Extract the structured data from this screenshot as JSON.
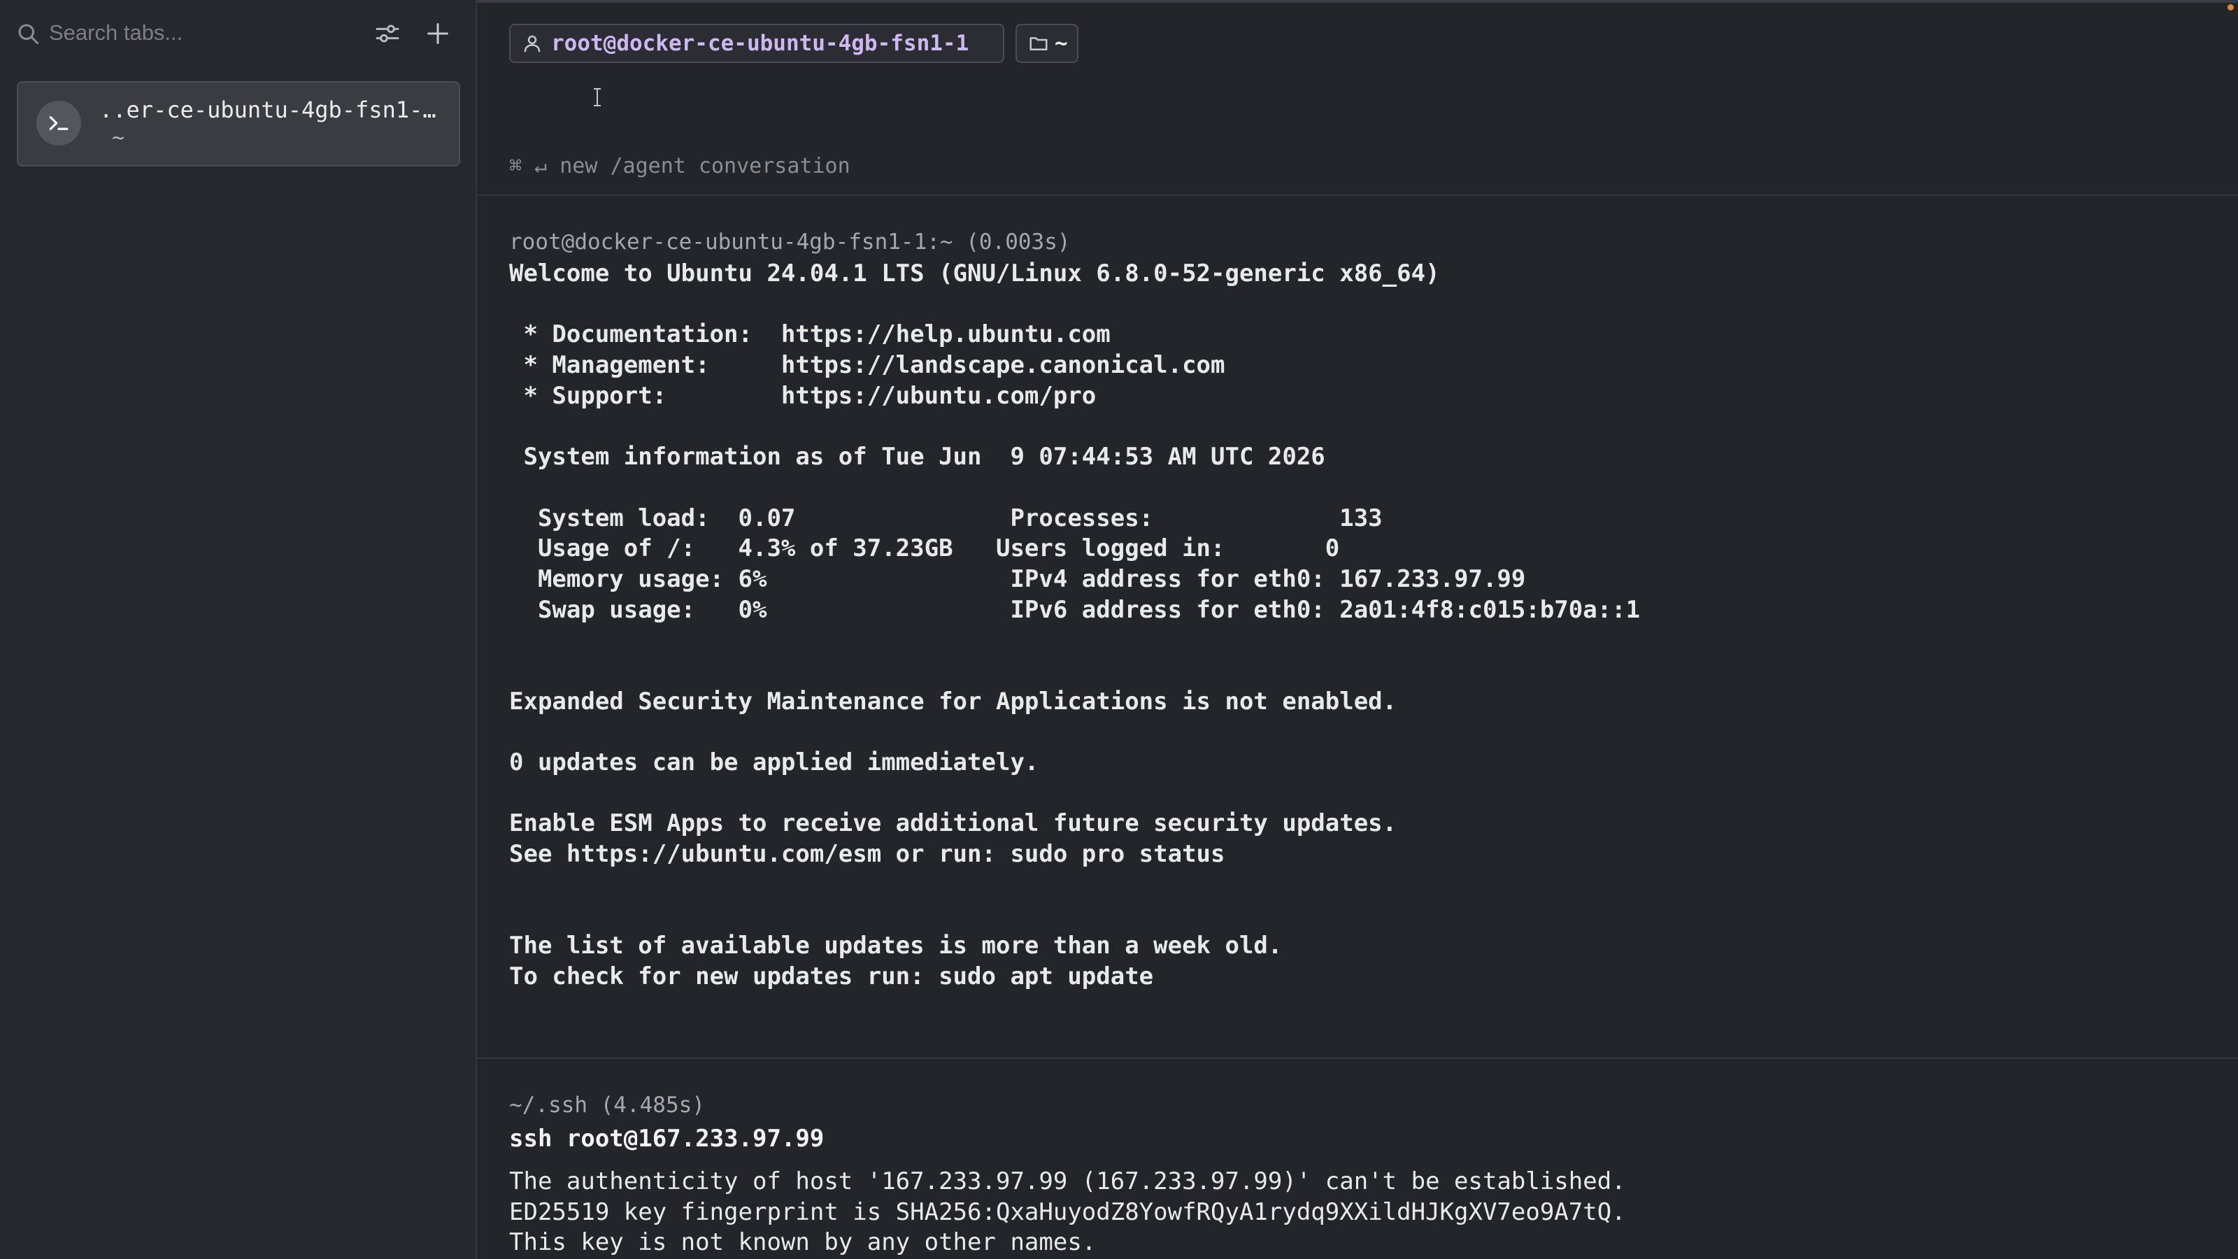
{
  "sidebar": {
    "search": {
      "placeholder": "Search tabs..."
    },
    "tabs": [
      {
        "title": "..er-ce-ubuntu-4gb-fsn1-…",
        "subtitle": "~"
      }
    ]
  },
  "header": {
    "user_host": "root@docker-ce-ubuntu-4gb-fsn1-1",
    "directory": "~"
  },
  "agent_hint": "⌘ ↵ new /agent conversation",
  "blocks": [
    {
      "header": "root@docker-ce-ubuntu-4gb-fsn1-1:~ (0.003s)",
      "lines": [
        "Welcome to Ubuntu 24.04.1 LTS (GNU/Linux 6.8.0-52-generic x86_64)",
        "",
        " * Documentation:  https://help.ubuntu.com",
        " * Management:     https://landscape.canonical.com",
        " * Support:        https://ubuntu.com/pro",
        "",
        " System information as of Tue Jun  9 07:44:53 AM UTC 2026",
        "",
        "  System load:  0.07               Processes:             133",
        "  Usage of /:   4.3% of 37.23GB   Users logged in:       0",
        "  Memory usage: 6%                 IPv4 address for eth0: 167.233.97.99",
        "  Swap usage:   0%                 IPv6 address for eth0: 2a01:4f8:c015:b70a::1",
        "",
        "",
        "Expanded Security Maintenance for Applications is not enabled.",
        "",
        "0 updates can be applied immediately.",
        "",
        "Enable ESM Apps to receive additional future security updates.",
        "See https://ubuntu.com/esm or run: sudo pro status",
        "",
        "",
        "The list of available updates is more than a week old.",
        "To check for new updates run: sudo apt update"
      ]
    },
    {
      "header": "~/.ssh (4.485s)",
      "command": "ssh root@167.233.97.99",
      "lines": [
        "The authenticity of host '167.233.97.99 (167.233.97.99)' can't be established.",
        "ED25519 key fingerprint is SHA256:QxaHuyodZ8YowfRQyA1rydq9XXildHJKgXV7eo9A7tQ.",
        "This key is not known by any other names."
      ]
    }
  ],
  "colors": {
    "background": "#23252a",
    "sidebar": "#26282d",
    "accent_purple": "#cdb8f0",
    "status_dot": "#e38a1e"
  }
}
